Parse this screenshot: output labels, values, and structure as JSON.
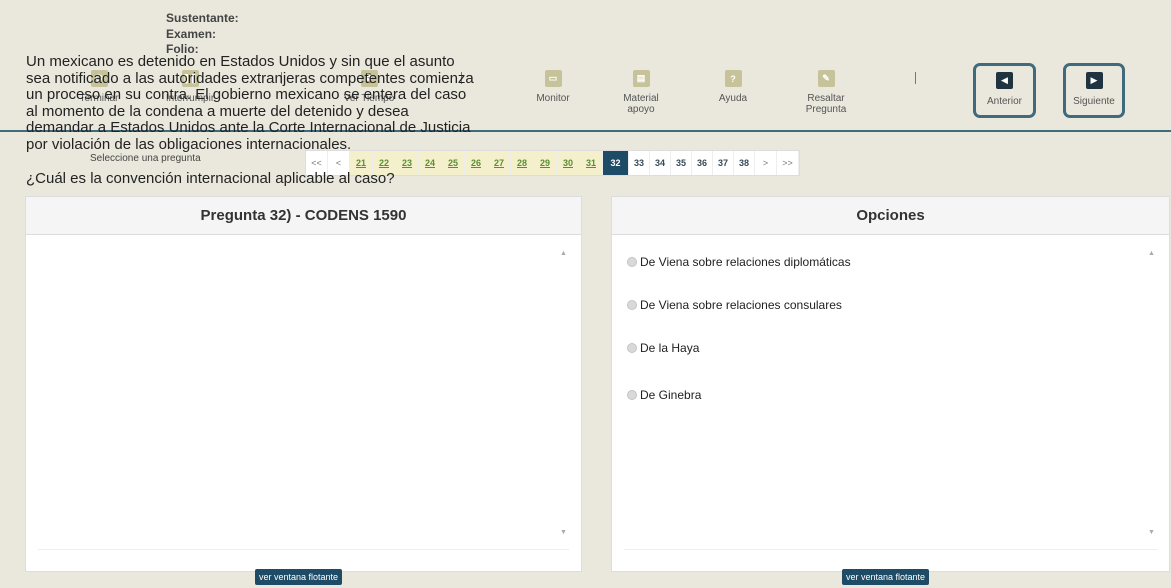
{
  "info": {
    "sustentante": "Sustentante:",
    "examen": "Examen:",
    "folio": "Folio:"
  },
  "toolbar": {
    "terminar": "Terminar",
    "interrumpir": "Interrumpir",
    "ver_tiempo": "Ver Tiempo",
    "monitor": "Monitor",
    "material_1": "Material",
    "material_2": "apoyo",
    "ayuda": "Ayuda",
    "resaltar_1": "Resaltar",
    "resaltar_2": "Pregunta",
    "anterior": "Anterior",
    "siguiente": "Siguiente",
    "separator": "|"
  },
  "pagination": {
    "label": "Seleccione una pregunta",
    "first": "<<",
    "prev": "<",
    "seen": [
      "21",
      "22",
      "23",
      "24",
      "25",
      "26",
      "27",
      "28",
      "29",
      "30",
      "31"
    ],
    "current": "32",
    "upcoming": [
      "33",
      "34",
      "35",
      "36",
      "37",
      "38"
    ],
    "next": ">",
    "last": ">>"
  },
  "question_panel": {
    "title": "Pregunta 32) - CODENS 1590",
    "text": "Un mexicano es detenido en Estados Unidos y sin que el asunto sea notificado a las autoridades extranjeras competentes comienza un proceso en su contra. El gobierno mexicano se entera del caso al momento de la condena a muerte del detenido y desea demandar a Estados Unidos ante la Corte Internacional de Justicia por violación de las obligaciones internacionales.",
    "prompt": "¿Cuál es la convención internacional aplicable al caso?",
    "float_button": "ver ventana flotante"
  },
  "options_panel": {
    "title": "Opciones",
    "options": [
      "De Viena sobre relaciones diplomáticas",
      "De Viena sobre relaciones consulares",
      "De la Haya",
      "De Ginebra"
    ],
    "float_button": "ver ventana flotante"
  },
  "colors": {
    "accent": "#1e4c67",
    "header_bg": "#eae8dd",
    "icon_bg": "#c6c39b",
    "seen_bg": "#f4f0cc",
    "seen_text": "#5b8d34"
  }
}
